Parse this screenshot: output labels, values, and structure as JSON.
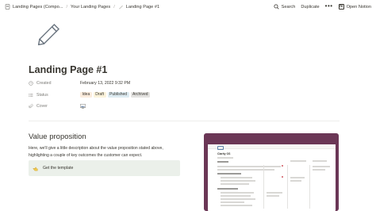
{
  "topbar": {
    "breadcrumbs": [
      {
        "label": "Landing Pages (Compo...",
        "icon": "page-icon"
      },
      {
        "label": "Your Landing Pages",
        "icon": ""
      },
      {
        "label": "Landing Page #1",
        "icon": "pencil-icon"
      }
    ],
    "search_label": "Search",
    "duplicate_label": "Duplicate",
    "more_label": "•••",
    "open_notion_label": "Open Notion"
  },
  "page": {
    "icon": "pencil-icon",
    "title": "Landing Page #1",
    "properties": {
      "created": {
        "label": "Created",
        "value": "February 13, 2022 9:32 PM"
      },
      "status": {
        "label": "Status",
        "tags": [
          {
            "label": "Idea",
            "color": "#fbecdd"
          },
          {
            "label": "Draft",
            "color": "#fbf3db"
          },
          {
            "label": "Published",
            "color": "#ddebf1"
          },
          {
            "label": "Archived",
            "color": "#e3e2e0"
          }
        ]
      },
      "cover": {
        "label": "Cover",
        "icon": "image-icon"
      }
    }
  },
  "content": {
    "heading": "Value proposition",
    "paragraph": "Here, we'll give a little description about the value proposition stated above, highlighting a couple of key outcomes the customer can expect.",
    "callout": {
      "icon": "hand-pointer-icon",
      "label": "Get the template"
    },
    "preview": {
      "title": "Clarity OS",
      "frame_color": "#6b3756"
    }
  }
}
